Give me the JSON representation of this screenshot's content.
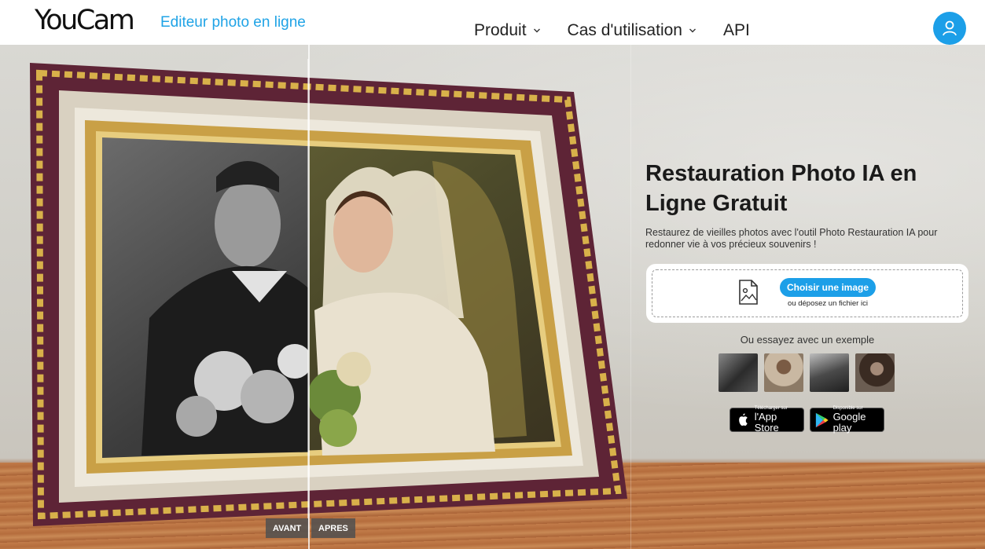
{
  "header": {
    "logo": "YouCam",
    "logo_subtitle": "Editeur photo en ligne",
    "nav": [
      {
        "label": "Produit",
        "has_dropdown": true
      },
      {
        "label": "Cas d'utilisation",
        "has_dropdown": true
      },
      {
        "label": "API",
        "has_dropdown": false
      }
    ],
    "user_icon": "user-icon"
  },
  "hero": {
    "compare": {
      "before": "AVANT",
      "after": "APRES"
    }
  },
  "panel": {
    "title": "Restauration Photo IA en Ligne Gratuit",
    "description": "Restaurez de vieilles photos avec l'outil Photo Restauration IA pour redonner vie à vos précieux souvenirs !",
    "upload": {
      "button": "Choisir une image",
      "drop_text": "ou déposez un fichier ici",
      "icon": "image-upload-icon"
    },
    "examples_label": "Ou essayez avec un exemple",
    "examples": [
      "example-1",
      "example-2",
      "example-3",
      "example-4"
    ],
    "stores": {
      "apple": {
        "small": "Télécharger sur",
        "big": "l'App Store"
      },
      "google": {
        "small": "Disponible sur",
        "big": "Google play"
      }
    }
  },
  "colors": {
    "accent": "#1c9fe8",
    "logo_sub": "#1fa3e6"
  }
}
